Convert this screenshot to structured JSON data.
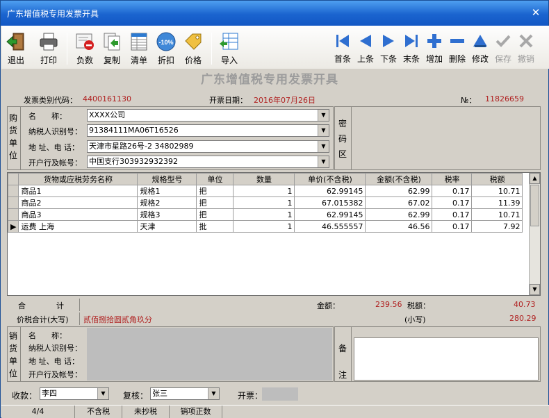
{
  "window": {
    "title": "广东增值税专用发票开具",
    "close_glyph": "✕"
  },
  "toolbar": {
    "left": [
      {
        "label": "退出",
        "icon": "exit-door-icon"
      },
      {
        "label": "打印",
        "icon": "printer-icon"
      },
      {
        "label": "负数",
        "icon": "negative-invoice-icon"
      },
      {
        "label": "复制",
        "icon": "copy-document-icon"
      },
      {
        "label": "清单",
        "icon": "list-sheet-icon"
      },
      {
        "label": "折扣",
        "icon": "discount-icon",
        "badge": "-10%"
      },
      {
        "label": "价格",
        "icon": "price-tag-icon"
      },
      {
        "label": "导入",
        "icon": "import-icon"
      }
    ],
    "right": [
      {
        "label": "首条",
        "icon": "first-record-icon",
        "enabled": true
      },
      {
        "label": "上条",
        "icon": "previous-record-icon",
        "enabled": true
      },
      {
        "label": "下条",
        "icon": "next-record-icon",
        "enabled": true
      },
      {
        "label": "末条",
        "icon": "last-record-icon",
        "enabled": true
      },
      {
        "label": "增加",
        "icon": "add-icon",
        "enabled": true
      },
      {
        "label": "删除",
        "icon": "delete-icon",
        "enabled": true
      },
      {
        "label": "修改",
        "icon": "edit-icon",
        "enabled": true
      },
      {
        "label": "保存",
        "icon": "save-check-icon",
        "enabled": false
      },
      {
        "label": "撤销",
        "icon": "undo-x-icon",
        "enabled": false
      }
    ]
  },
  "heading": "广东增值税专用发票开具",
  "invoice": {
    "code_label": "发票类别代码：",
    "code_value": "4400161130",
    "date_label": "开票日期：",
    "date_value": "2016年07月26日",
    "no_label": "№：",
    "no_value": "11826659"
  },
  "buyer": {
    "section_label": [
      "购",
      "货",
      "单",
      "位"
    ],
    "name_label": "名　　称：",
    "name_value": "XXXX公司",
    "tax_label": "纳税人识别号：",
    "tax_value": "91384111MA06T16526",
    "addr_label": "地 址、电 话：",
    "addr_value": "天津市星路26号-2 34802989",
    "bank_label": "开户行及帐号：",
    "bank_value": "中国支行303932932392"
  },
  "cipher_label": [
    "密",
    "码",
    "区"
  ],
  "grid": {
    "columns": [
      "货物或应税劳务名称",
      "规格型号",
      "单位",
      "数量",
      "单价(不含税)",
      "金额(不含税)",
      "税率",
      "税额"
    ],
    "rows": [
      {
        "name": "商品1",
        "spec": "规格1",
        "unit": "把",
        "qty": "1",
        "price": "62.99145",
        "amount": "62.99",
        "rate": "0.17",
        "tax": "10.71",
        "current": false
      },
      {
        "name": "商品2",
        "spec": "规格2",
        "unit": "把",
        "qty": "1",
        "price": "67.015382",
        "amount": "67.02",
        "rate": "0.17",
        "tax": "11.39",
        "current": false
      },
      {
        "name": "商品3",
        "spec": "规格3",
        "unit": "把",
        "qty": "1",
        "price": "62.99145",
        "amount": "62.99",
        "rate": "0.17",
        "tax": "10.71",
        "current": false
      },
      {
        "name": "运费 上海",
        "spec": "天津",
        "unit": "批",
        "qty": "1",
        "price": "46.555557",
        "amount": "46.56",
        "rate": "0.17",
        "tax": "7.92",
        "current": true
      }
    ],
    "current_row_glyph": "▶"
  },
  "totals": {
    "sum_label": "合　　　　计",
    "amount_label": "金额：",
    "amount_value": "239.56",
    "tax_label": "税额：",
    "tax_value": "40.73",
    "caps_label": "价税合计(大写)",
    "caps_value": "贰佰捌拾圆贰角玖分",
    "small_label": "(小写)",
    "small_value": "280.29"
  },
  "seller": {
    "section_label": [
      "销",
      "货",
      "单",
      "位"
    ],
    "name_label": "名　　称：",
    "tax_label": "纳税人识别号：",
    "addr_label": "地 址、电 话：",
    "bank_label": "开户行及帐号："
  },
  "remark_label": [
    "备",
    "注"
  ],
  "footer": {
    "payee_label": "收款：",
    "payee_value": "李四",
    "reviewer_label": "复核：",
    "reviewer_value": "张三",
    "issuer_label": "开票："
  },
  "status": [
    "4/4",
    "不含税",
    "未抄税",
    "销项正数"
  ]
}
